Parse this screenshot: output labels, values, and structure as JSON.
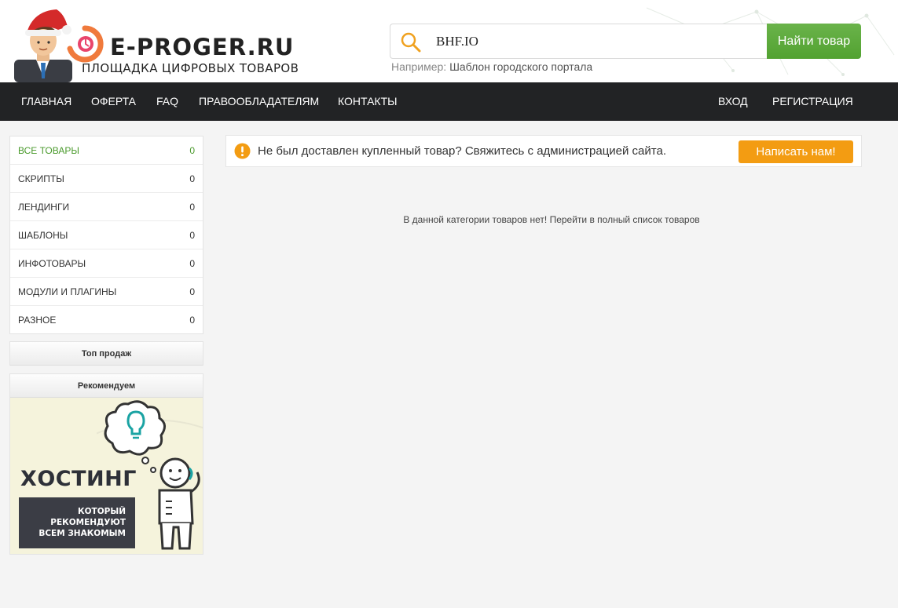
{
  "brand": {
    "title": "E-PROGER.RU",
    "subtitle": "ПЛОЩАДКА ЦИФРОВЫХ ТОВАРОВ"
  },
  "search": {
    "value": "BHF.IO",
    "button_label": "Найти товар",
    "hint_prefix": "Например:",
    "hint_example": "Шаблон городского портала"
  },
  "nav": {
    "left": [
      "ГЛАВНАЯ",
      "ОФЕРТА",
      "FAQ",
      "ПРАВООБЛАДАТЕЛЯМ",
      "КОНТАКТЫ"
    ],
    "login": "ВХОД",
    "register": "РЕГИСТРАЦИЯ"
  },
  "categories": [
    {
      "label": "ВСЕ ТОВАРЫ",
      "count": "0"
    },
    {
      "label": "СКРИПТЫ",
      "count": "0"
    },
    {
      "label": "ЛЕНДИНГИ",
      "count": "0"
    },
    {
      "label": "ШАБЛОНЫ",
      "count": "0"
    },
    {
      "label": "ИНФОТОВАРЫ",
      "count": "0"
    },
    {
      "label": "МОДУЛИ И ПЛАГИНЫ",
      "count": "0"
    },
    {
      "label": "РАЗНОЕ",
      "count": "0"
    }
  ],
  "sidebar": {
    "top_sales": "Топ продаж",
    "recommend": "Рекомендуем",
    "banner_title": "ХОСТИНГ",
    "banner_text": "КОТОРЫЙ\nРЕКОМЕНДУЮТ\nВСЕМ ЗНАКОМЫМ"
  },
  "alert": {
    "text": "Не был доставлен купленный товар? Свяжитесь с администрацией сайта.",
    "button": "Написать нам!"
  },
  "empty": {
    "message": "В данной категории товаров нет!",
    "link": "Перейти в полный список товаров"
  },
  "colors": {
    "green": "#52a231",
    "orange": "#f39c12",
    "nav_bg": "#222325",
    "active_category": "#4a9a2c"
  },
  "icons": {
    "search": "magnifier-icon",
    "alert": "exclamation-icon"
  }
}
